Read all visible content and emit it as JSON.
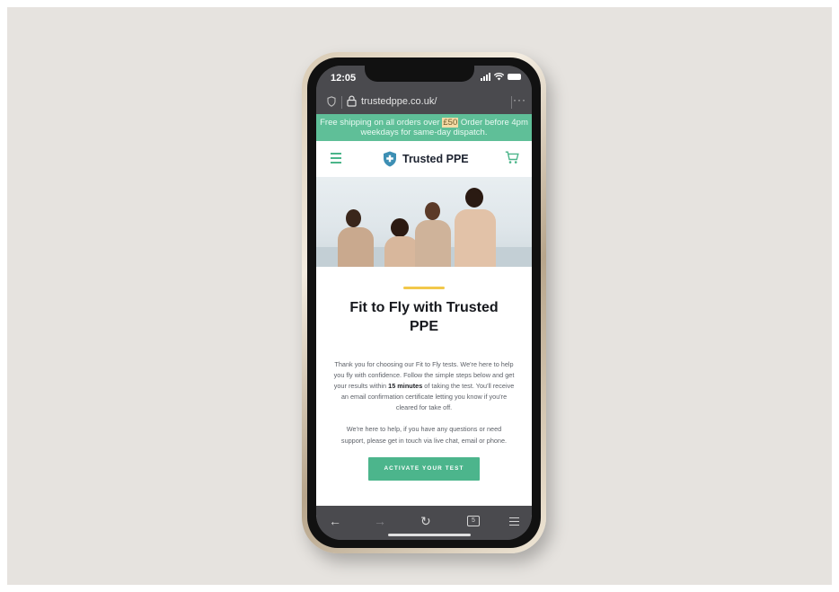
{
  "status_bar": {
    "time": "12:05"
  },
  "browser": {
    "url": "trustedppe.co.uk/",
    "more_label": "···"
  },
  "promo": {
    "part1": "Free shipping on all orders over ",
    "highlight": "£50",
    "part2": " Order before 4pm weekdays for same-day dispatch."
  },
  "site": {
    "brand": "Trusted PPE",
    "brand_color": "#4bb58a"
  },
  "main": {
    "title": "Fit to Fly with Trusted PPE",
    "intro_part1": "Thank you for choosing our Fit to Fly tests. We're here to help you fly with confidence. Follow the simple steps below and get your results within ",
    "intro_bold": "15 minutes",
    "intro_part2": " of taking the test. You'll receive an email confirmation certificate letting you know if you're cleared for take off.",
    "help_text": "We're here to help, if you have any questions or need support, please get in touch via live chat, email or phone.",
    "cta_label": "ACTIVATE YOUR TEST"
  },
  "toolbar": {
    "back": "←",
    "forward": "→",
    "reload": "↻",
    "tab_count": "5"
  },
  "colors": {
    "promo_bg": "#5fbf98",
    "accent_line": "#f2c84b",
    "cta_bg": "#4cb58c"
  }
}
